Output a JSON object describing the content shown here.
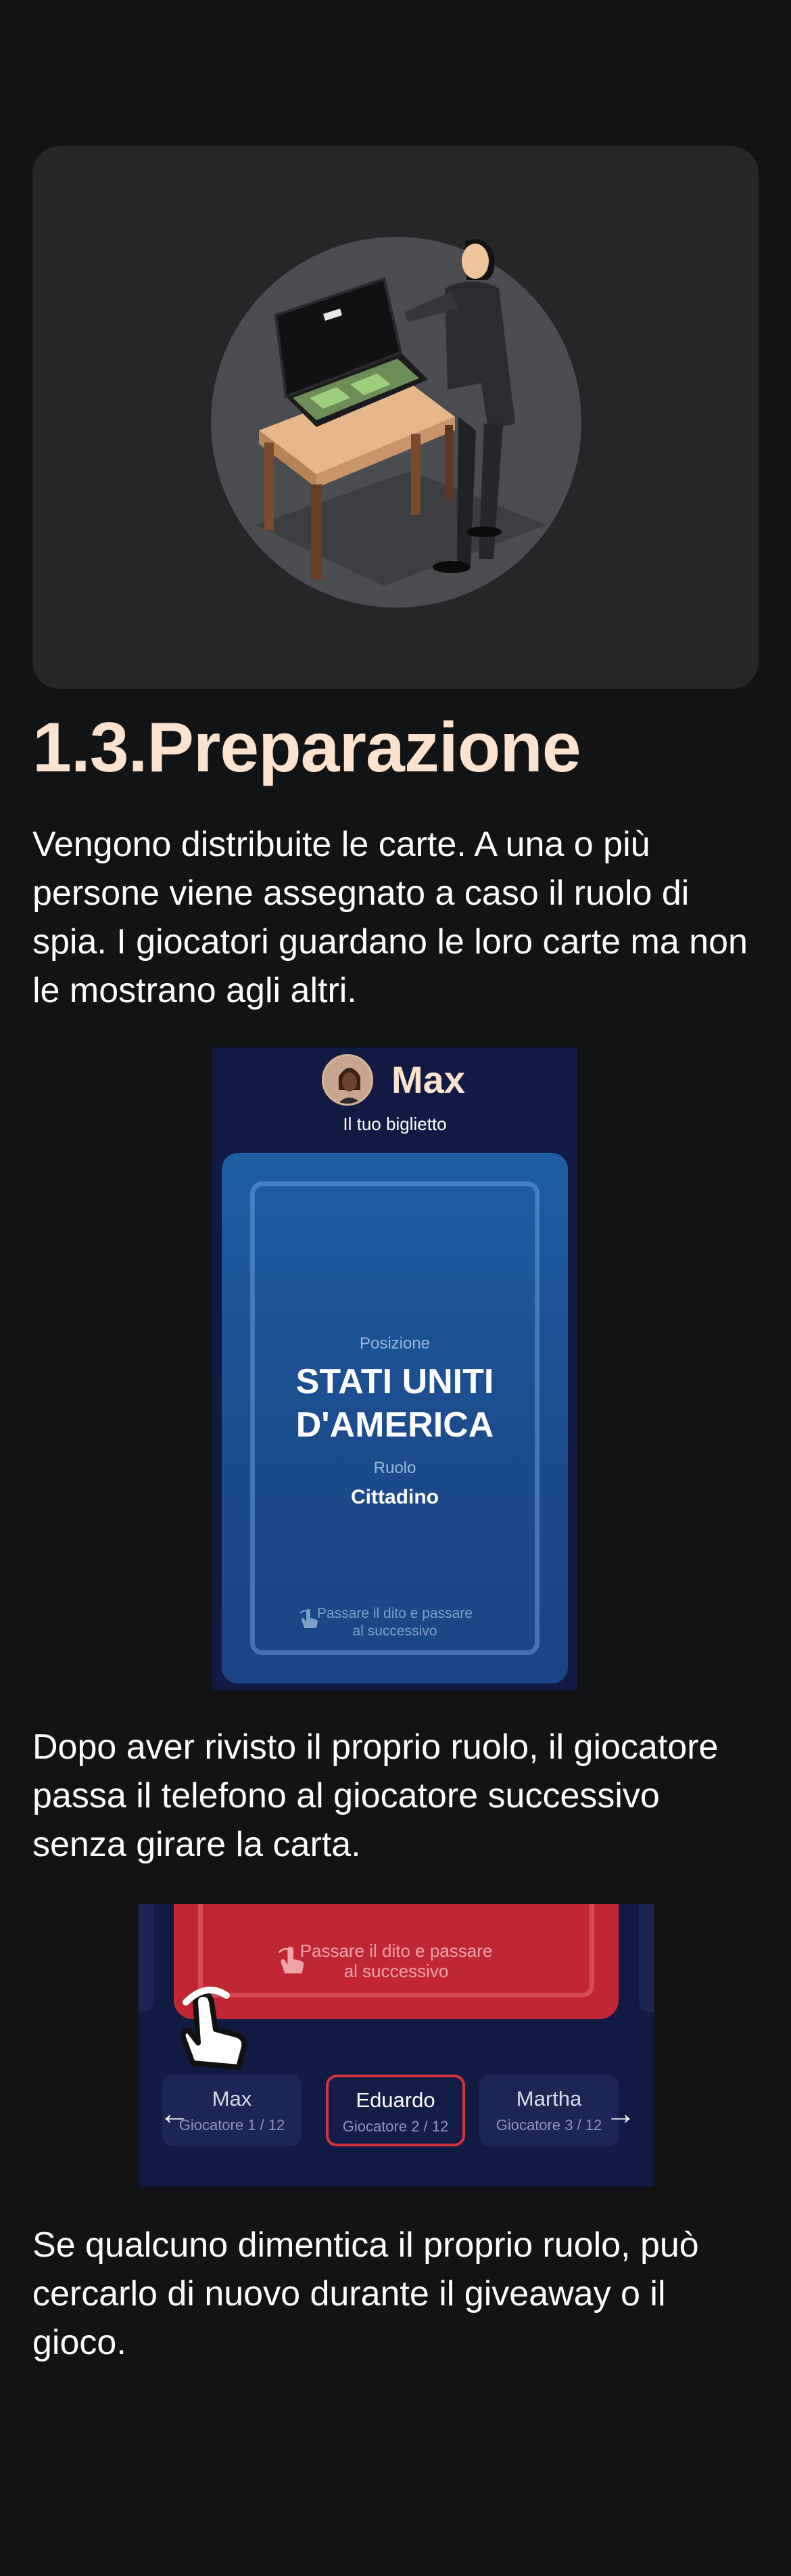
{
  "section": {
    "title": "1.3.Preparazione",
    "intro": "Vengono distribuite le carte. A una o più persone viene assegnato a caso il ruolo di spia. I giocatori guardano le loro carte ma non le mostrano agli altri.",
    "after_review": "Dopo aver rivisto il proprio ruolo, il giocatore passa il telefono al giocatore successivo senza girare la carta.",
    "forgot_role": "Se qualcuno dimentica il proprio ruolo, può cercarlo di nuovo durante il giveaway o il gioco."
  },
  "card_screen": {
    "player_name": "Max",
    "ticket_label": "Il tuo biglietto",
    "position_label": "Posizione",
    "position_value_line1": "STATI UNITI",
    "position_value_line2": "D'AMERICA",
    "role_label": "Ruolo",
    "role_value": "Cittadino",
    "swipe_line1": "Passare il dito e passare",
    "swipe_line2": "al successivo"
  },
  "pass_screen": {
    "swipe_line1": "Passare il dito e passare",
    "swipe_line2": "al successivo",
    "players": [
      {
        "name": "Max",
        "subtitle": "Giocatore 1 / 12"
      },
      {
        "name": "Eduardo",
        "subtitle": "Giocatore 2 / 12"
      },
      {
        "name": "Martha",
        "subtitle": "Giocatore 3 / 12"
      }
    ],
    "active_index": 1
  },
  "colors": {
    "background": "#121315",
    "title": "#fbe3cf",
    "card_blue": "#1e5da3",
    "card_red": "#c02733",
    "accent_red": "#d8313f"
  }
}
